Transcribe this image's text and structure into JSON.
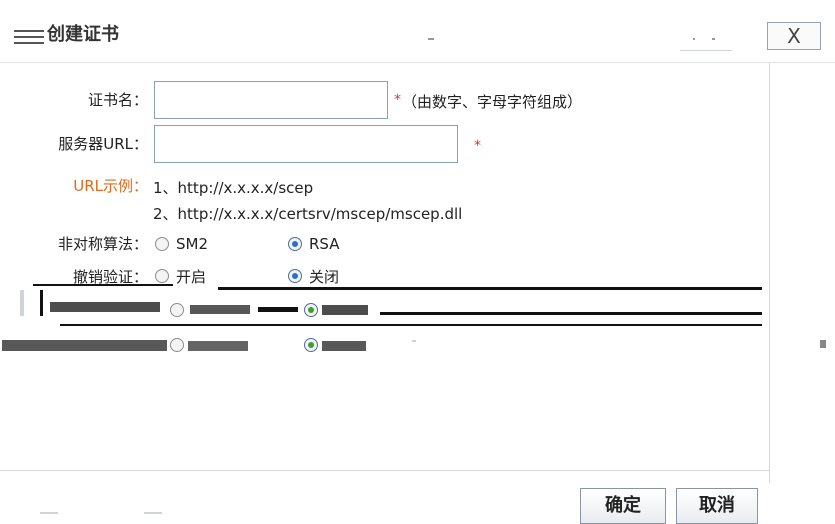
{
  "dialog": {
    "title": "创建证书",
    "close_label": "X"
  },
  "form": {
    "cert_name": {
      "label": "证书名：",
      "value": "",
      "required": "*",
      "hint": "（由数字、字母字符组成）"
    },
    "server_url": {
      "label": "服务器URL：",
      "value": "",
      "required": "*"
    },
    "url_example": {
      "label": "URL示例：",
      "line1": "1、http://x.x.x.x/scep",
      "line2": "2、http://x.x.x.x/certsrv/mscep/mscep.dll"
    },
    "algorithm": {
      "label": "非对称算法：",
      "options": [
        "SM2",
        "RSA"
      ],
      "selected": "RSA"
    },
    "revocation": {
      "label": "撤销验证：",
      "options": [
        "开启",
        "关闭"
      ],
      "selected": "关闭"
    }
  },
  "footer": {
    "ok_label": "确定",
    "cancel_label": "取消"
  },
  "colors": {
    "required": "#e0322c",
    "example_label": "#e06a1a",
    "radio_selected": "#2a6fd0"
  }
}
